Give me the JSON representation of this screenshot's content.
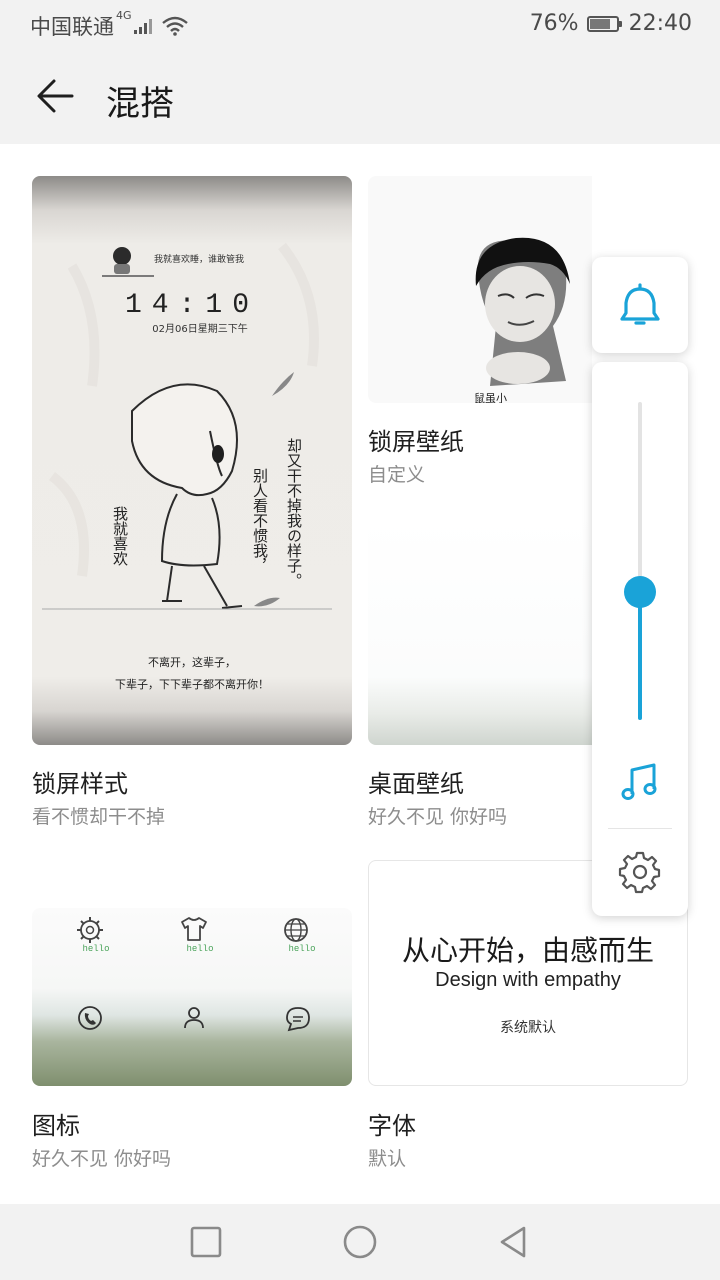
{
  "status_bar": {
    "carrier": "中国联通",
    "network": "4G",
    "battery_percent": "76%",
    "battery_level": 0.76,
    "time": "22:40"
  },
  "header": {
    "title": "混搭"
  },
  "cards": [
    {
      "title": "锁屏样式",
      "subtitle": "看不惯却干不掉"
    },
    {
      "title": "锁屏壁纸",
      "subtitle": "自定义"
    },
    {
      "title": "桌面壁纸",
      "subtitle": "好久不见 你好吗"
    },
    {
      "title": "图标",
      "subtitle": "好久不见 你好吗"
    },
    {
      "title": "字体",
      "subtitle": "默认"
    }
  ],
  "lock_preview": {
    "top_caption": "我就喜欢睡，谁敢管我",
    "clock": "14:10",
    "date": "02月06日星期三下午",
    "vertical_1": "却又干不掉我の样子。",
    "vertical_2": "别人看不惯我，",
    "vertical_3": "我就喜欢",
    "bottom_1": "不离开，这辈子，",
    "bottom_2": "下辈子，下下辈子都不离开你！"
  },
  "icon_preview": {
    "hello": "hello"
  },
  "font_preview": {
    "headline": "从心开始，由感而生",
    "tagline": "Design with empathy",
    "label": "系统默认"
  },
  "volume_panel": {
    "level": 0.4,
    "accent_color": "#1aa3d8",
    "icons": [
      "bell-icon",
      "music-note-icon",
      "gear-icon"
    ]
  },
  "nav_bar": {
    "icons": [
      "recent-apps-icon",
      "home-icon",
      "back-triangle-icon"
    ]
  }
}
